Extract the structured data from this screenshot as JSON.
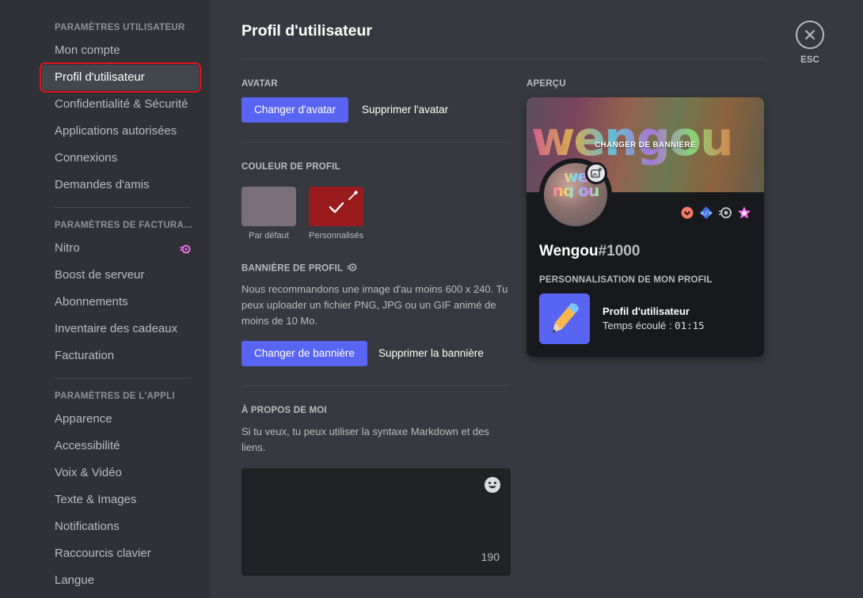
{
  "sidebar": {
    "user_settings_header": "PARAMÈTRES UTILISATEUR",
    "user_items": [
      {
        "label": "Mon compte"
      },
      {
        "label": "Profil d'utilisateur"
      },
      {
        "label": "Confidentialité & Sécurité"
      },
      {
        "label": "Applications autorisées"
      },
      {
        "label": "Connexions"
      },
      {
        "label": "Demandes d'amis"
      }
    ],
    "billing_header": "PARAMÈTRES DE FACTURATION",
    "billing_items": [
      {
        "label": "Nitro"
      },
      {
        "label": "Boost de serveur"
      },
      {
        "label": "Abonnements"
      },
      {
        "label": "Inventaire des cadeaux"
      },
      {
        "label": "Facturation"
      }
    ],
    "app_header": "PARAMÈTRES DE L'APPLI",
    "app_items": [
      {
        "label": "Apparence"
      },
      {
        "label": "Accessibilité"
      },
      {
        "label": "Voix & Vidéo"
      },
      {
        "label": "Texte & Images"
      },
      {
        "label": "Notifications"
      },
      {
        "label": "Raccourcis clavier"
      },
      {
        "label": "Langue"
      }
    ]
  },
  "main": {
    "title": "Profil d'utilisateur",
    "avatar": {
      "label": "AVATAR",
      "change_button": "Changer d'avatar",
      "remove_button": "Supprimer l'avatar"
    },
    "profile_color": {
      "label": "COULEUR DE PROFIL",
      "default_label": "Par défaut",
      "custom_label": "Personnalisés",
      "default_color": "#7a6f78",
      "custom_color": "#9a1b1e"
    },
    "banner": {
      "label": "BANNIÈRE DE PROFIL",
      "description": "Nous recommandons une image d'au moins 600 x 240. Tu peux uploader un fichier PNG, JPG ou un GIF animé de moins de 10 Mo.",
      "change_button": "Changer de bannière",
      "remove_button": "Supprimer la bannière"
    },
    "about": {
      "label": "À PROPOS DE MOI",
      "description": "Si tu veux, tu peux utiliser la syntaxe Markdown et des liens.",
      "char_count": "190"
    }
  },
  "preview": {
    "label": "APERÇU",
    "banner_text": "wengou",
    "banner_cta": "CHANGER DE BANNIÈRE",
    "avatar_text": "we ng ou",
    "username": "Wengou",
    "discriminator": "#1000",
    "customize_label": "PERSONNALISATION DE MON PROFIL",
    "activity_title": "Profil d'utilisateur",
    "activity_time_prefix": "Temps écoulé : ",
    "activity_time": "01:15"
  },
  "close": {
    "label": "ESC"
  },
  "colors": {
    "accent": "#5865f2",
    "selection_highlight": "#e0161b",
    "nitro": "#ff73fa"
  }
}
